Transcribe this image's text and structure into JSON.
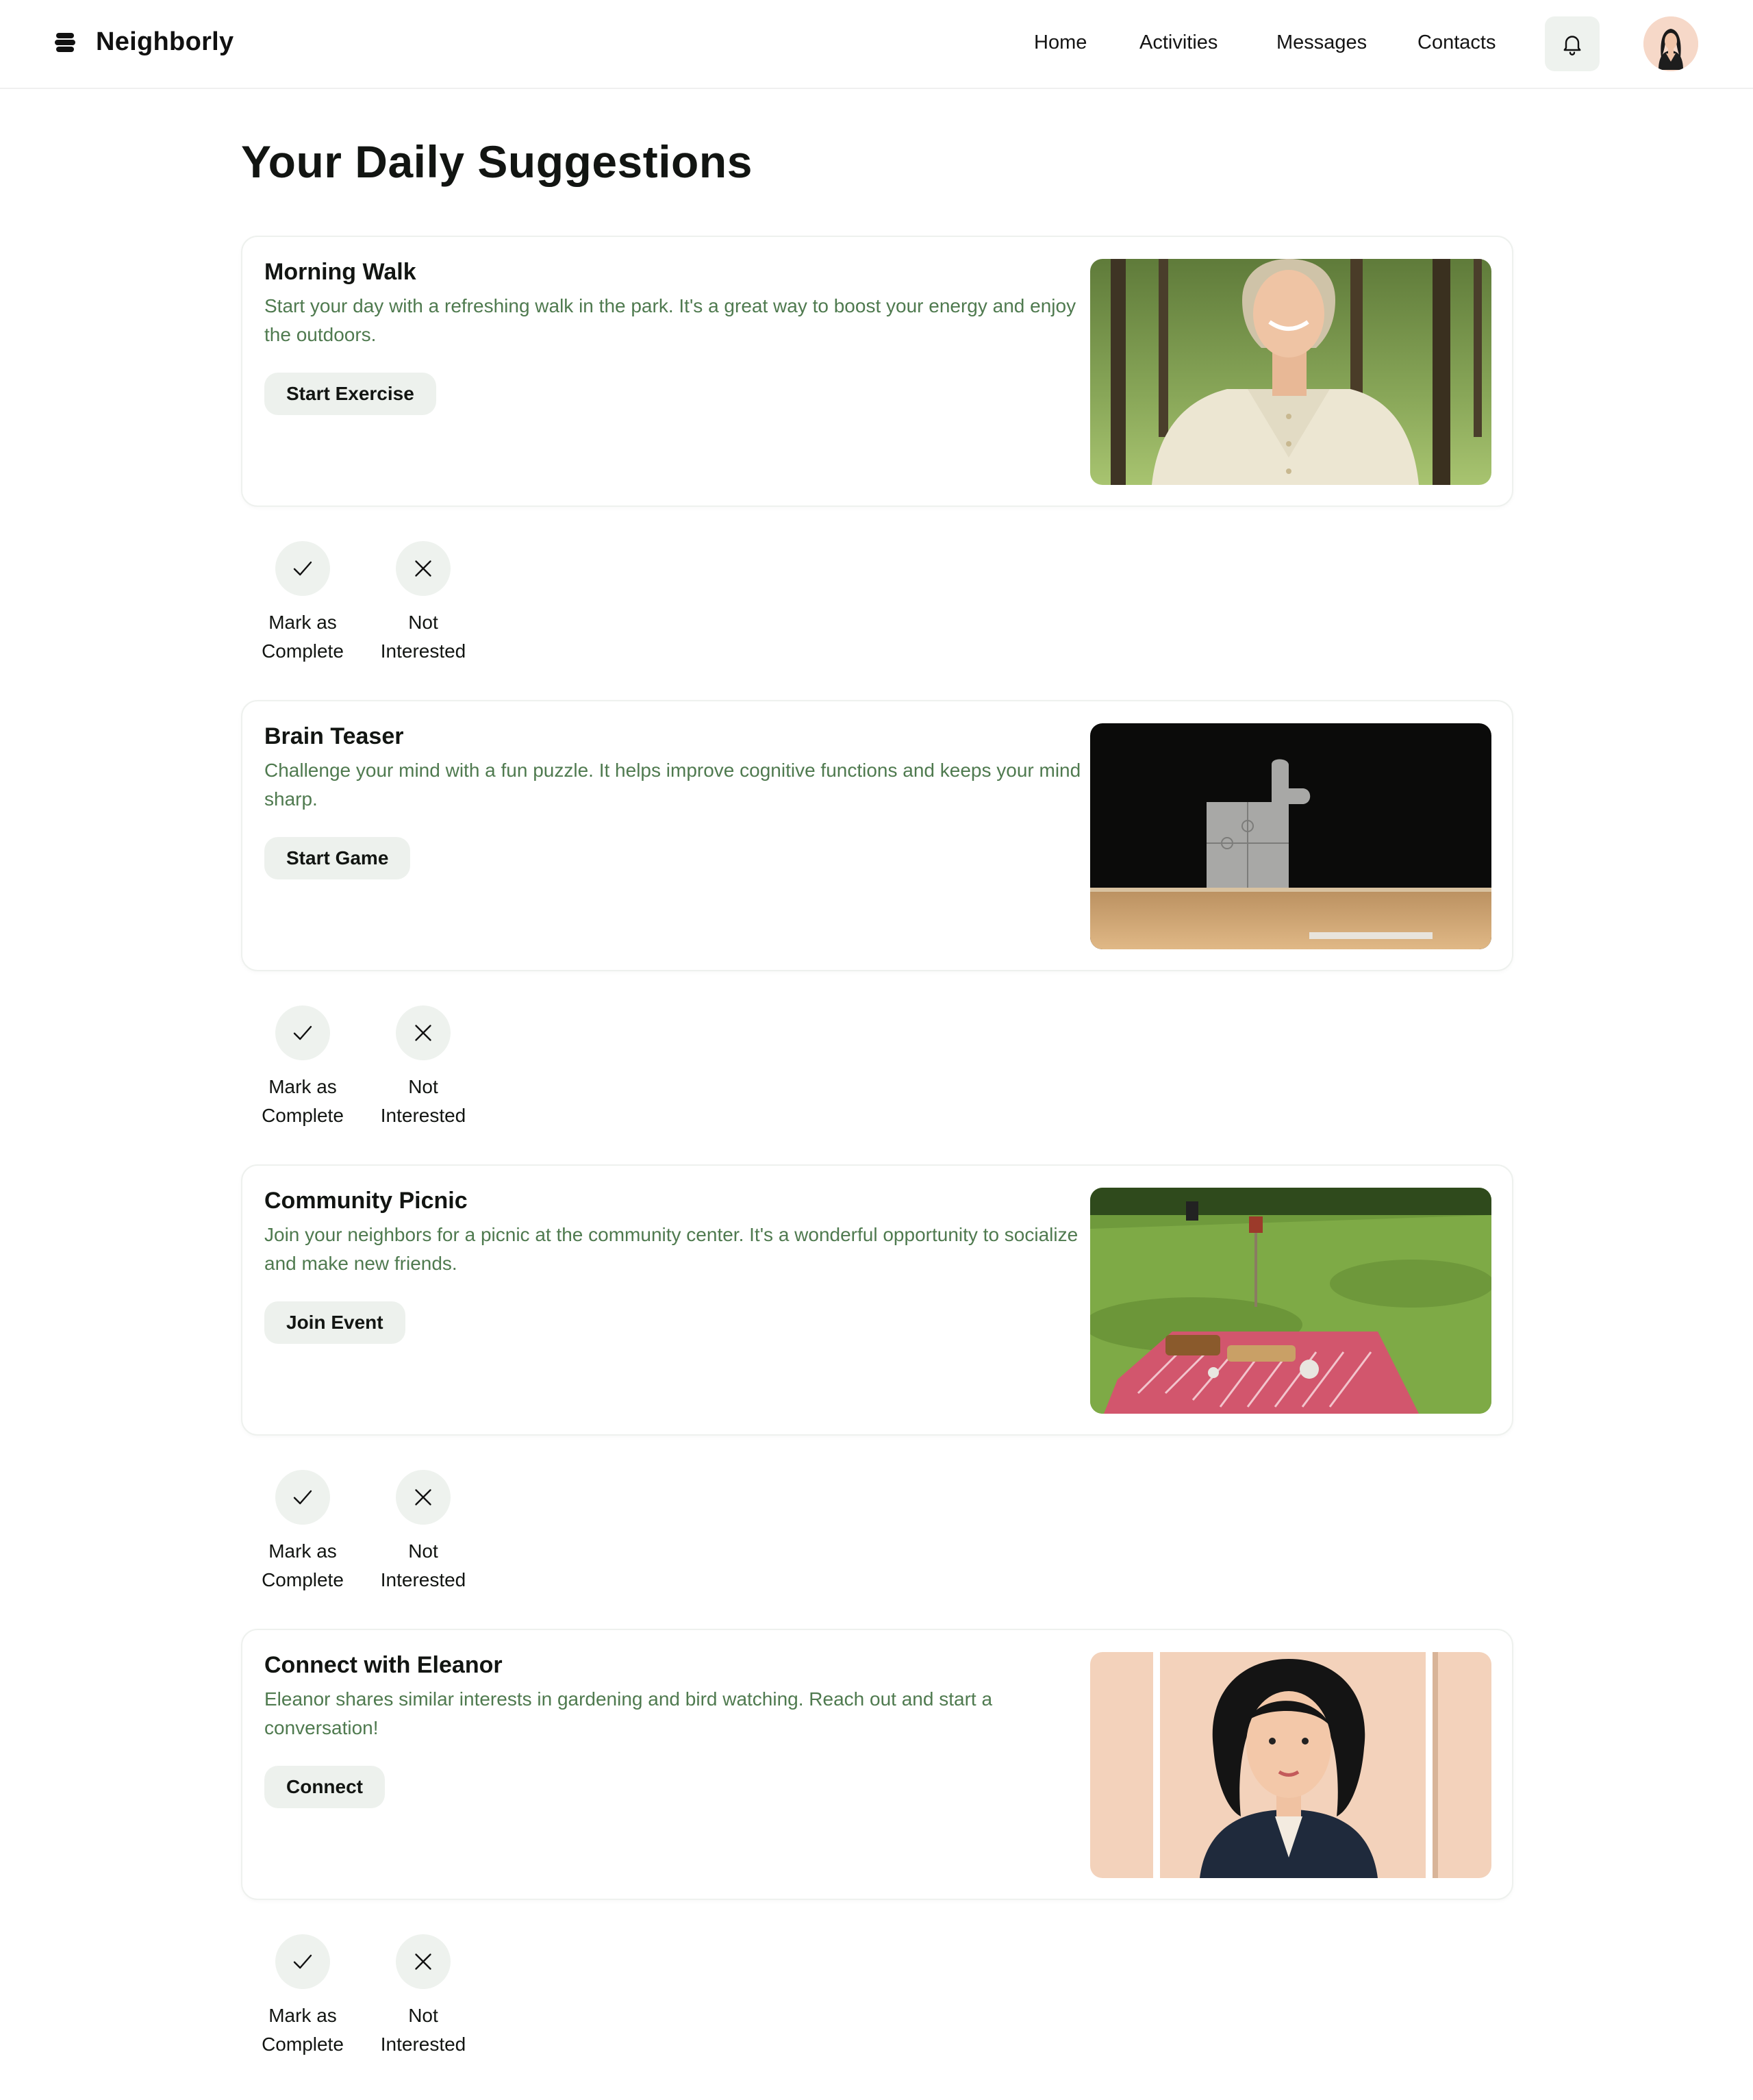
{
  "app": {
    "name": "Neighborly"
  },
  "nav": [
    {
      "label": "Home"
    },
    {
      "label": "Activities"
    },
    {
      "label": "Messages"
    },
    {
      "label": "Contacts"
    }
  ],
  "page": {
    "title": "Your Daily Suggestions"
  },
  "suggestions": [
    {
      "title": "Morning Walk",
      "description": "Start your day with a refreshing walk in the park. It's a great way to boost your energy and enjoy the outdoors.",
      "button": "Start Exercise"
    },
    {
      "title": "Brain Teaser",
      "description": "Challenge your mind with a fun puzzle. It helps improve cognitive functions and keeps your mind sharp.",
      "button": "Start Game"
    },
    {
      "title": "Community Picnic",
      "description": "Join your neighbors for a picnic at the community center. It's a wonderful opportunity to socialize and make new friends.",
      "button": "Join Event"
    },
    {
      "title": "Connect with Eleanor",
      "description": "Eleanor shares similar interests in gardening and bird watching. Reach out and start a conversation!",
      "button": "Connect"
    }
  ],
  "actions": {
    "complete_line1": "Mark as",
    "complete_line2": "Complete",
    "dismiss_line1": "Not",
    "dismiss_line2": "Interested"
  },
  "icons": {
    "logo": "logo-icon",
    "notifications": "bell-icon",
    "complete": "check-icon",
    "dismiss": "close-icon"
  },
  "colors": {
    "accent_text": "#4f7a4f",
    "button_bg": "#edf1ed",
    "text": "#121512"
  }
}
